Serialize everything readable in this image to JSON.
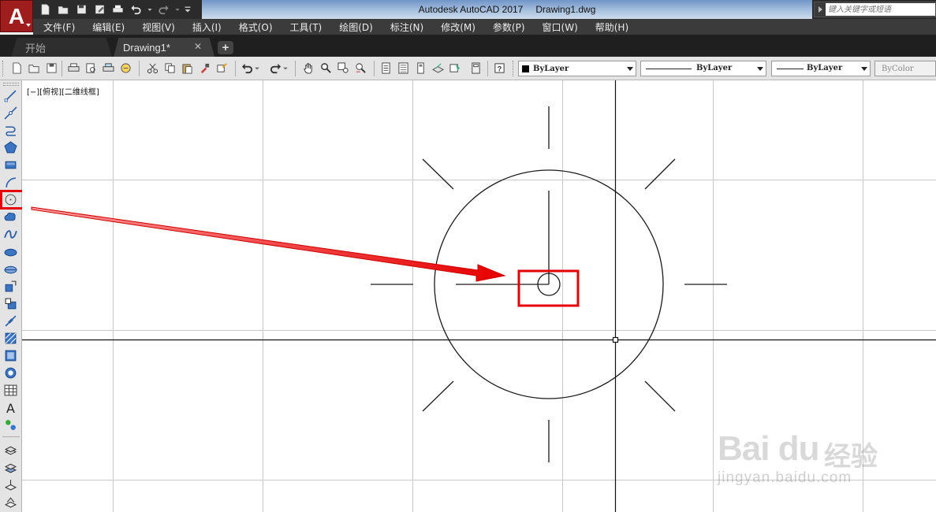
{
  "app": {
    "logo_letter": "A",
    "title_app": "Autodesk AutoCAD 2017",
    "title_file": "Drawing1.dwg",
    "search_placeholder": "键入关键字或短语"
  },
  "menu": [
    "文件(F)",
    "编辑(E)",
    "视图(V)",
    "插入(I)",
    "格式(O)",
    "工具(T)",
    "绘图(D)",
    "标注(N)",
    "修改(M)",
    "参数(P)",
    "窗口(W)",
    "帮助(H)"
  ],
  "tabs": {
    "start": "开始",
    "drawing": "Drawing1*",
    "close": "✕",
    "add": "+"
  },
  "toolbar": {
    "color": "ByLayer",
    "linetype": "ByLayer",
    "lineweight": "ByLayer",
    "plotstyle": "ByColor"
  },
  "viewport_label": "[−][俯视][二维线框]",
  "draw_tools": [
    "line-icon",
    "construction-line-icon",
    "polyline-icon",
    "polygon-icon",
    "rectangle-icon",
    "arc-icon",
    "circle-icon",
    "revision-cloud-icon",
    "spline-icon",
    "ellipse-icon",
    "ellipse-arc-icon",
    "insert-block-icon",
    "make-block-icon",
    "point-icon",
    "hatch-icon",
    "gradient-icon",
    "region-icon",
    "table-icon",
    "multiline-text-icon",
    "add-selected-icon"
  ],
  "annotation": {
    "highlight_color": "#e60000",
    "highlighted_tool": "circle-icon"
  },
  "watermark": {
    "brand": "Bai du",
    "cn": "经验",
    "url": "jingyan.baidu.com"
  },
  "colors": {
    "titlebar": "#2b2b2b",
    "menubar": "#3b3b3b",
    "toolbar": "#e4e4e4",
    "app_button": "#a01d1d",
    "grid": "#c8c8c8",
    "geometry": "#1a1a1a"
  }
}
